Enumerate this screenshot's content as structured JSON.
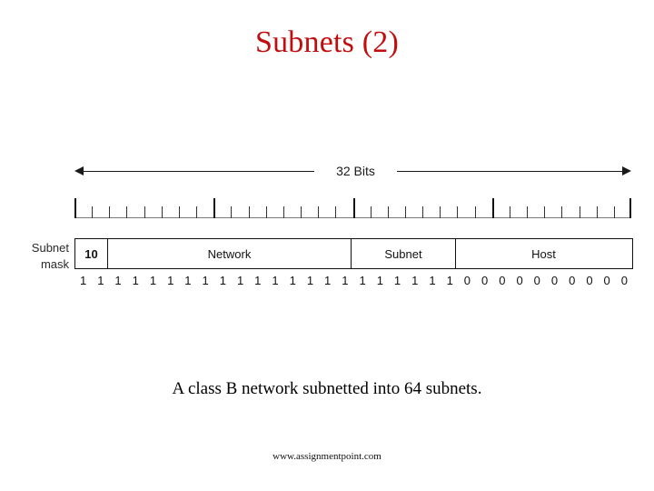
{
  "slide": {
    "title": "Subnets (2)",
    "title_color": "#c00d0d",
    "caption": "A class B network subnetted into 64 subnets.",
    "footer": "www.assignmentpoint.com"
  },
  "figure": {
    "width_label": "32 Bits",
    "mask_label_line1": "Subnet",
    "mask_label_line2": "mask",
    "total_bits": 32,
    "fields": [
      {
        "label": "10",
        "bits": 2
      },
      {
        "label": "Network",
        "bits": 14
      },
      {
        "label": "Subnet",
        "bits": 6
      },
      {
        "label": "Host",
        "bits": 10
      }
    ],
    "mask_bits": [
      "1",
      "1",
      "1",
      "1",
      "1",
      "1",
      "1",
      "1",
      "1",
      "1",
      "1",
      "1",
      "1",
      "1",
      "1",
      "1",
      "1",
      "1",
      "1",
      "1",
      "1",
      "1",
      "0",
      "0",
      "0",
      "0",
      "0",
      "0",
      "0",
      "0",
      "0",
      "0"
    ],
    "ruler_tick_count": 32,
    "ruler_major_every": 8,
    "line_color": "#111111"
  }
}
